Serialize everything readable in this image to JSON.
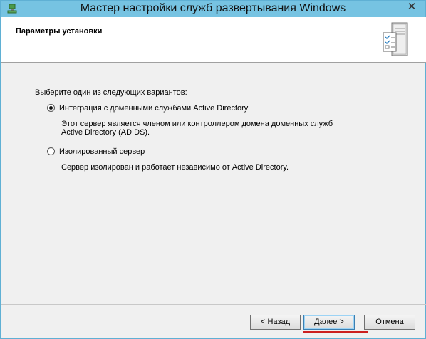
{
  "window": {
    "title": "Мастер настройки служб развертывания Windows",
    "close_glyph": "✕",
    "app_icon": "wds-app-icon"
  },
  "header": {
    "title": "Параметры установки",
    "graphic": "server-checklist-icon"
  },
  "content": {
    "prompt": "Выберите один из следующих вариантов:",
    "options": [
      {
        "label": "Интеграция с доменными службами Active Directory",
        "selected": true,
        "description_lines": [
          "Этот сервер является членом или контроллером домена доменных служб",
          "Active Directory (AD DS)."
        ]
      },
      {
        "label": "Изолированный сервер",
        "selected": false,
        "description_lines": [
          "Сервер изолирован и работает независимо от Active Directory."
        ]
      }
    ]
  },
  "buttons": {
    "back": "< Назад",
    "next": "Далее >",
    "cancel": "Отмена"
  },
  "colors": {
    "titlebar": "#76c3e2",
    "annotation_underline": "#cc1f1f"
  }
}
